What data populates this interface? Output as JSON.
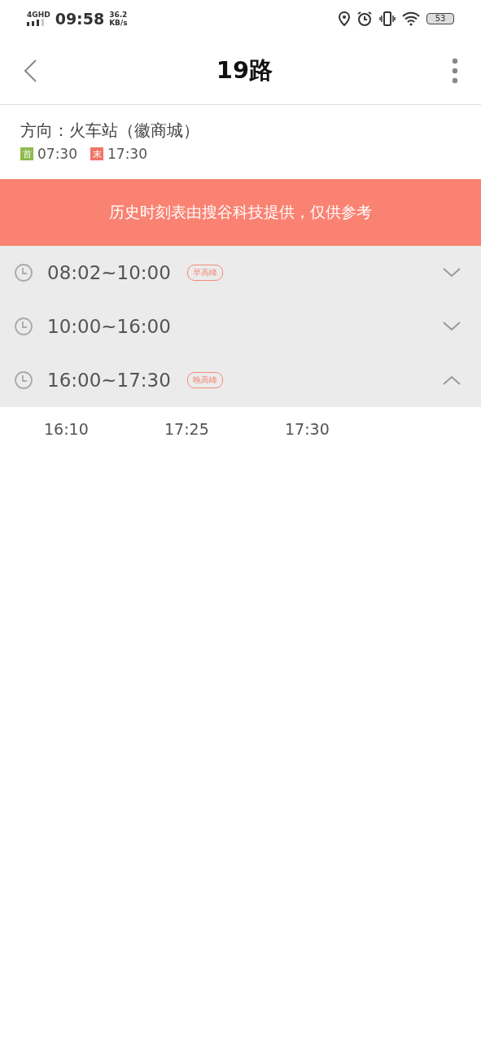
{
  "status_bar": {
    "network": "4GHD",
    "time": "09:58",
    "speed": "36.2",
    "speed_unit": "KB/s",
    "battery": "53"
  },
  "header": {
    "title": "19路"
  },
  "direction": {
    "label": "方向：火车站（徽商城）",
    "first": {
      "tag": "首",
      "time": "07:30"
    },
    "last": {
      "tag": "末",
      "time": "17:30"
    }
  },
  "notice": "历史时刻表由搜谷科技提供，仅供参考",
  "periods": [
    {
      "range": "08:02~10:00",
      "badge": "早高峰",
      "expanded": false
    },
    {
      "range": "10:00~16:00",
      "expanded": false
    },
    {
      "range": "16:00~17:30",
      "badge": "晚高峰",
      "expanded": true,
      "times": [
        "16:10",
        "17:25",
        "17:30"
      ]
    }
  ]
}
